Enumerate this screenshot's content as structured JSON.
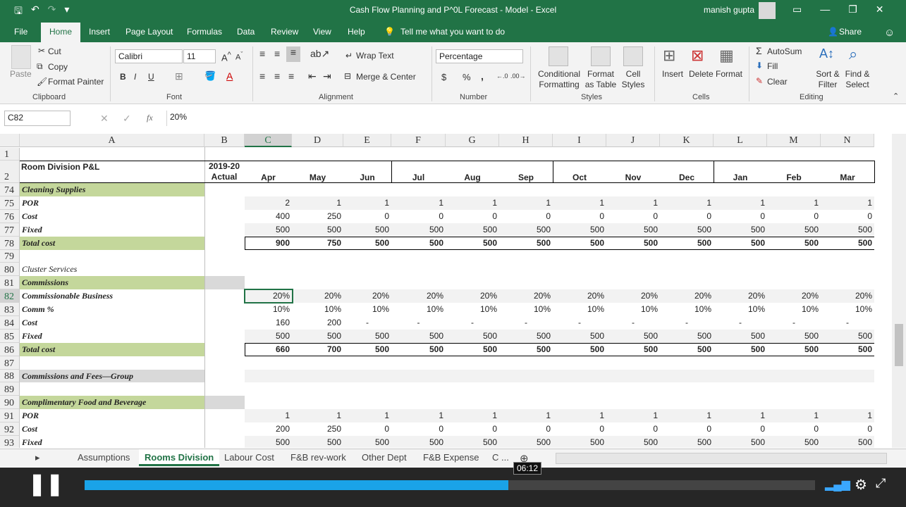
{
  "window": {
    "title": "Cash Flow Planning and P^0L Forecast - Model  -  Excel",
    "user": "manish gupta"
  },
  "ribbon_tabs": [
    "File",
    "Home",
    "Insert",
    "Page Layout",
    "Formulas",
    "Data",
    "Review",
    "View",
    "Help"
  ],
  "tell_me": "Tell me what you want to do",
  "share_label": "Share",
  "clipboard": {
    "paste": "Paste",
    "cut": "Cut",
    "copy": "Copy",
    "format_painter": "Format Painter",
    "label": "Clipboard"
  },
  "font": {
    "name": "Calibri",
    "size": "11",
    "label": "Font",
    "bold": "B",
    "italic": "I",
    "underline": "U"
  },
  "alignment": {
    "wrap_text": "Wrap Text",
    "merge_center": "Merge & Center",
    "label": "Alignment"
  },
  "number": {
    "format": "Percentage",
    "currency": "$",
    "percent": "%",
    "comma": ",",
    "label": "Number"
  },
  "styles": {
    "conditional": "Conditional Formatting",
    "format_table": "Format as Table",
    "cell_styles": "Cell Styles",
    "label": "Styles"
  },
  "cells_group": {
    "insert": "Insert",
    "delete": "Delete",
    "format": "Format",
    "label": "Cells"
  },
  "editing": {
    "autosum": "AutoSum",
    "fill": "Fill",
    "clear": "Clear",
    "sort_filter": "Sort & Filter",
    "find_select": "Find & Select",
    "label": "Editing"
  },
  "formula_bar": {
    "name_box": "C82",
    "fx": "fx",
    "value": "20%"
  },
  "columns": [
    "A",
    "B",
    "C",
    "D",
    "E",
    "F",
    "G",
    "H",
    "I",
    "J",
    "K",
    "L",
    "M",
    "N"
  ],
  "header": {
    "title": "Room Division P&L",
    "actual_year": "2019-20",
    "actual_label": "Actual",
    "months": [
      "Apr",
      "May",
      "Jun",
      "Jul",
      "Aug",
      "Sep",
      "Oct",
      "Nov",
      "Dec",
      "Jan",
      "Feb",
      "Mar"
    ]
  },
  "rows": [
    {
      "num": "74",
      "label": "Cleaning Supplies",
      "style": "green",
      "values": []
    },
    {
      "num": "75",
      "label": "POR",
      "band": true,
      "values": [
        "2",
        "1",
        "1",
        "1",
        "1",
        "1",
        "1",
        "1",
        "1",
        "1",
        "1",
        "1"
      ]
    },
    {
      "num": "76",
      "label": "Cost",
      "values": [
        "400",
        "250",
        "0",
        "0",
        "0",
        "0",
        "0",
        "0",
        "0",
        "0",
        "0",
        "0"
      ]
    },
    {
      "num": "77",
      "label": "Fixed",
      "band": true,
      "values": [
        "500",
        "500",
        "500",
        "500",
        "500",
        "500",
        "500",
        "500",
        "500",
        "500",
        "500",
        "500"
      ]
    },
    {
      "num": "78",
      "label": "Total cost",
      "style": "green",
      "total": true,
      "values": [
        "900",
        "750",
        "500",
        "500",
        "500",
        "500",
        "500",
        "500",
        "500",
        "500",
        "500",
        "500"
      ]
    },
    {
      "num": "79",
      "label": "",
      "values": []
    },
    {
      "num": "80",
      "label": "Cluster Services",
      "plain": true,
      "values": []
    },
    {
      "num": "81",
      "label": "Commissions",
      "style": "green",
      "greyB": true,
      "values": []
    },
    {
      "num": "82",
      "label": "Commissionable Business",
      "band": true,
      "values": [
        "20%",
        "20%",
        "20%",
        "20%",
        "20%",
        "20%",
        "20%",
        "20%",
        "20%",
        "20%",
        "20%",
        "20%"
      ]
    },
    {
      "num": "83",
      "label": "Comm %",
      "values": [
        "10%",
        "10%",
        "10%",
        "10%",
        "10%",
        "10%",
        "10%",
        "10%",
        "10%",
        "10%",
        "10%",
        "10%"
      ]
    },
    {
      "num": "84",
      "label": "Cost",
      "values": [
        "160",
        "200",
        "-",
        "-",
        "-",
        "-",
        "-",
        "-",
        "-",
        "-",
        "-",
        "-"
      ]
    },
    {
      "num": "85",
      "label": "Fixed",
      "band": true,
      "values": [
        "500",
        "500",
        "500",
        "500",
        "500",
        "500",
        "500",
        "500",
        "500",
        "500",
        "500",
        "500"
      ]
    },
    {
      "num": "86",
      "label": "Total cost",
      "style": "green",
      "total": true,
      "values": [
        "660",
        "700",
        "500",
        "500",
        "500",
        "500",
        "500",
        "500",
        "500",
        "500",
        "500",
        "500"
      ]
    },
    {
      "num": "87",
      "label": "",
      "values": []
    },
    {
      "num": "88",
      "label": "Commissions and Fees—Group",
      "style": "grey",
      "band": true,
      "values": []
    },
    {
      "num": "89",
      "label": "",
      "values": []
    },
    {
      "num": "90",
      "label": "Complimentary Food and Beverage",
      "style": "green",
      "greyB": true,
      "values": []
    },
    {
      "num": "91",
      "label": "POR",
      "band": true,
      "values": [
        "1",
        "1",
        "1",
        "1",
        "1",
        "1",
        "1",
        "1",
        "1",
        "1",
        "1",
        "1"
      ]
    },
    {
      "num": "92",
      "label": "Cost",
      "values": [
        "200",
        "250",
        "0",
        "0",
        "0",
        "0",
        "0",
        "0",
        "0",
        "0",
        "0",
        "0"
      ]
    },
    {
      "num": "93",
      "label": "Fixed",
      "band": true,
      "values": [
        "500",
        "500",
        "500",
        "500",
        "500",
        "500",
        "500",
        "500",
        "500",
        "500",
        "500",
        "500"
      ]
    }
  ],
  "sheet_tabs": [
    "Assumptions",
    "Rooms Division",
    "Labour Cost",
    "F&B rev-work",
    "Other Dept",
    "F&B Expense",
    "C ..."
  ],
  "active_sheet": "Rooms Division",
  "video": {
    "time": "06:12",
    "progress": 0.58
  }
}
